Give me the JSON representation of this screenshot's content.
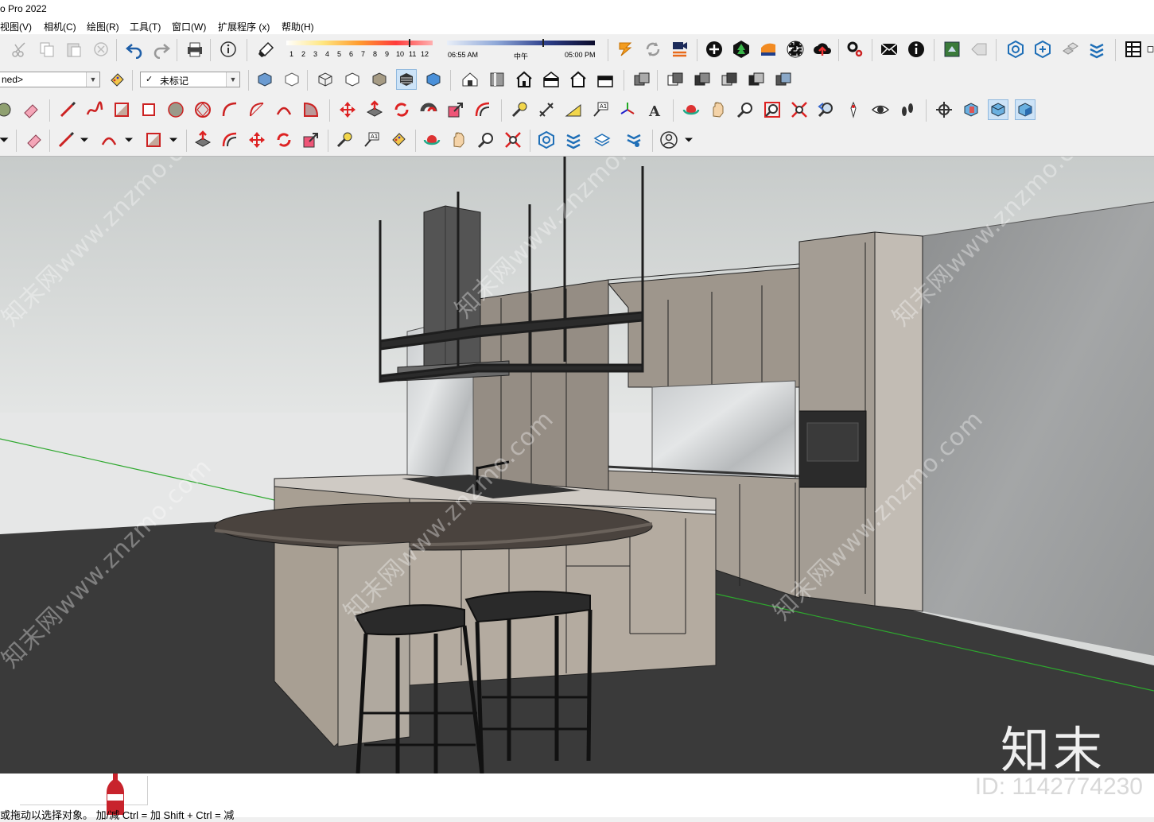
{
  "window": {
    "title": "o Pro 2022"
  },
  "menu": [
    "视图(V)",
    "相机(C)",
    "绘图(R)",
    "工具(T)",
    "窗口(W)",
    "扩展程序 (x)",
    "帮助(H)"
  ],
  "shadow_bar": {
    "months": [
      "1",
      "2",
      "3",
      "4",
      "5",
      "6",
      "7",
      "8",
      "9",
      "10",
      "11",
      "12"
    ],
    "time_start": "06:55 AM",
    "time_mid": "中午",
    "time_end": "05:00 PM"
  },
  "combos": {
    "style": "ned>",
    "tag": "未标记"
  },
  "viewport": {
    "brand": "知末",
    "watermark": "知末网www.znzmo.com"
  },
  "status": {
    "id": "ID: 1142774230",
    "hint": "或拖动以选择对象。    加/减   Ctrl = 加   Shift + Ctrl = 减"
  },
  "colors": {
    "accent": "#0078d7",
    "axis_green": "#2ea82e",
    "floor": "#3a3a3a"
  }
}
